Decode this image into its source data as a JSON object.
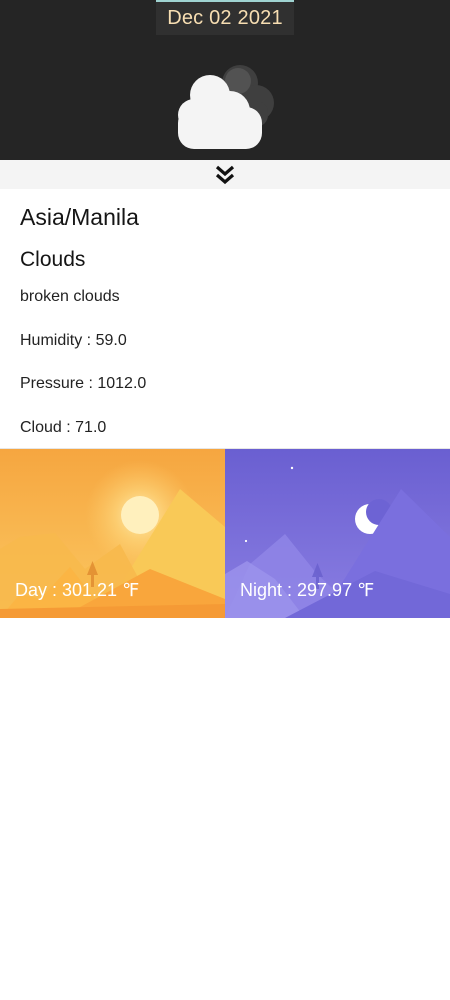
{
  "header": {
    "date": "Dec 02 2021",
    "weather_icon": "cloud-icon"
  },
  "expand": {
    "icon": "double-chevron-down-icon"
  },
  "details": {
    "location": "Asia/Manila",
    "condition": "Clouds",
    "description": "broken clouds",
    "humidity": "Humidity : 59.0",
    "pressure": "Pressure : 1012.0",
    "cloud": "Cloud : 71.0"
  },
  "cards": {
    "day": "Day : 301.21 ℉",
    "night": "Night : 297.97 ℉"
  },
  "colors": {
    "header_bg": "#252525",
    "date_text": "#f7deb2",
    "day_gradient_top": "#f6b24a",
    "night_gradient_top": "#6a5fd1"
  }
}
